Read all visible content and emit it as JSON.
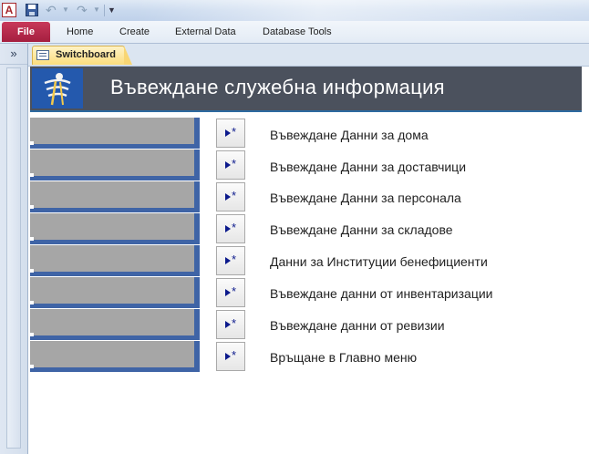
{
  "quick_access": {
    "app_icon_letter": "A"
  },
  "ribbon": {
    "file": "File",
    "tabs": [
      "Home",
      "Create",
      "External Data",
      "Database Tools"
    ]
  },
  "nav": {
    "toggle": "»"
  },
  "document_tab": {
    "label": "Switchboard"
  },
  "form": {
    "title": "Въвеждане служебна информация",
    "items": [
      "Въвеждане Данни за дома",
      "Въвеждане Данни за доставчици",
      "Въвеждане Данни за персонала",
      "Въвеждане Данни за складове",
      "Данни за Институции бенефициенти",
      "Въвеждане данни от инвентаризации",
      "Въвеждане данни от ревизии",
      "Връщане в Главно меню"
    ]
  },
  "colors": {
    "header_bg": "#4b515d",
    "accent_blue": "#3f64a6",
    "file_tab": "#a51f3f",
    "tab_gold": "#fbdd7d"
  }
}
